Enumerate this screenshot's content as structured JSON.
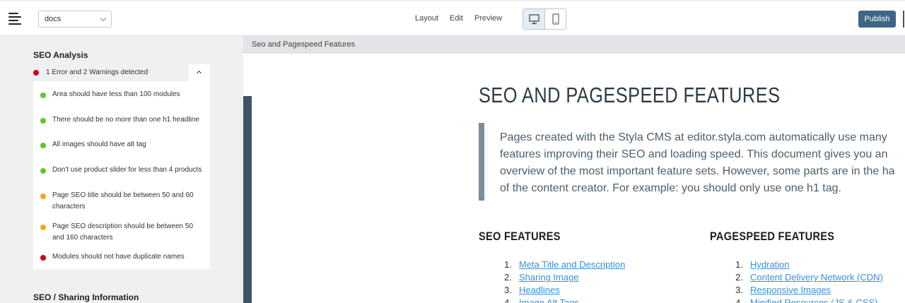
{
  "topbar": {
    "site_select": "docs",
    "modes": [
      "Layout",
      "Edit",
      "Preview"
    ],
    "publish_label": "Publish"
  },
  "sidebar": {
    "seo_title": "SEO Analysis",
    "summary": "1 Error and 2 Warnings detected",
    "checks": [
      {
        "text": "Area should have less than 100 modules",
        "status": "ok"
      },
      {
        "text": "There should be no more than one h1 headline",
        "status": "ok"
      },
      {
        "text": "All images should have alt tag",
        "status": "ok"
      },
      {
        "text": "Don't use product slider for less than 4 products",
        "status": "ok"
      },
      {
        "text": "Page SEO title should be between 50 and 60 characters",
        "status": "warning"
      },
      {
        "text": "Page SEO description should be between 50 and 160 characters",
        "status": "warning"
      },
      {
        "text": "Modules should not have duplicate names",
        "status": "error"
      }
    ],
    "sharing_title": "SEO / Sharing Information"
  },
  "status_colors": {
    "ok": "#5ec72c",
    "warning": "#f5a623",
    "error": "#d0021b"
  },
  "main": {
    "breadcrumb": "Seo and Pagespeed Features",
    "title": "SEO AND PAGESPEED FEATURES",
    "intro_lines": [
      "Pages created with the Styla CMS at editor.styla.com automatically use many",
      "features improving their SEO and loading speed. This document gives you an",
      "overview of the most important feature sets. However, some parts are in the ha",
      "of the content creator. For example: you should only use one h1 tag."
    ],
    "seo_heading": "SEO FEATURES",
    "seo_items": [
      "Meta Title and Description",
      "Sharing Image",
      "Headlines",
      "Image Alt Tags"
    ],
    "speed_heading": "PAGESPEED FEATURES",
    "speed_items": [
      "Hydration",
      "Content Delivery Network (CDN)",
      "Responsive Images",
      "Minified Resources (JS & CSS)"
    ]
  }
}
